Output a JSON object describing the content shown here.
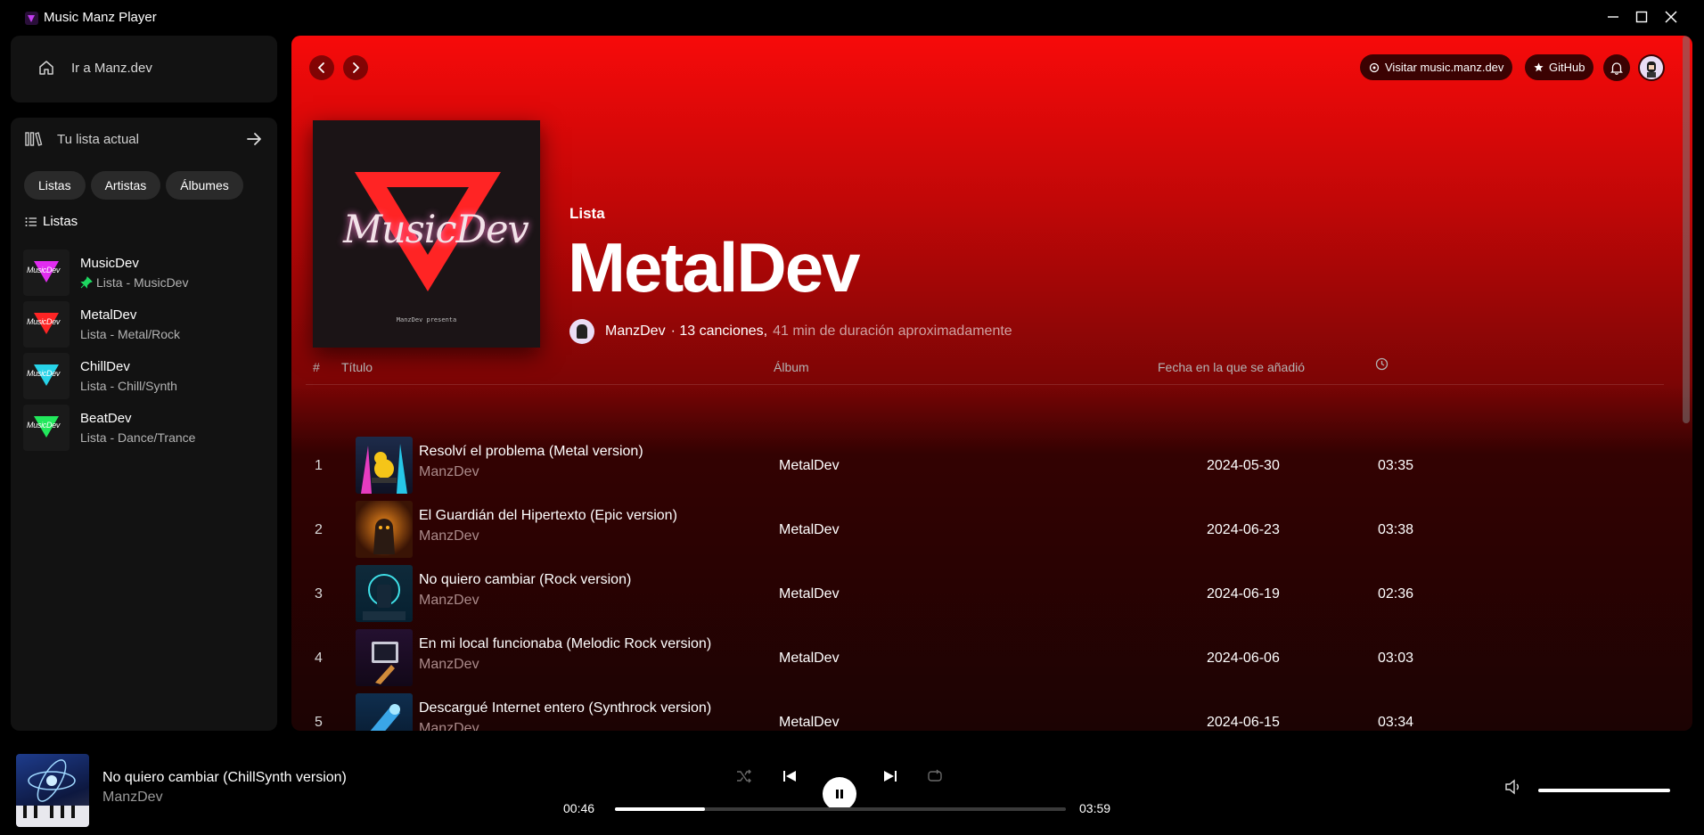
{
  "window": {
    "title": "Music Manz Player"
  },
  "home": {
    "label": "Ir a Manz.dev"
  },
  "library": {
    "header": "Tu lista actual",
    "chips": [
      "Listas",
      "Artistas",
      "Álbumes"
    ],
    "section_label": "Listas",
    "playlists": [
      {
        "name": "MusicDev",
        "subtitle": "Lista - MusicDev",
        "color": "#e22cf0",
        "pinned": true
      },
      {
        "name": "MetalDev",
        "subtitle": "Lista - Metal/Rock",
        "color": "#ff2424",
        "pinned": false
      },
      {
        "name": "ChillDev",
        "subtitle": "Lista - Chill/Synth",
        "color": "#27d3e8",
        "pinned": false
      },
      {
        "name": "BeatDev",
        "subtitle": "Lista - Dance/Trance",
        "color": "#22e85c",
        "pinned": false
      }
    ]
  },
  "topbar": {
    "visit_label": "Visitar music.manz.dev",
    "github_label": "GitHub"
  },
  "playlist_header": {
    "kind": "Lista",
    "title": "MetalDev",
    "cover_text": "MusicDev",
    "cover_credit": "ManzDev presenta",
    "owner": "ManzDev",
    "song_count": "· 13 canciones,",
    "duration": "41 min de duración aproximadamente"
  },
  "table": {
    "headers": {
      "num": "#",
      "title": "Título",
      "album": "Álbum",
      "date": "Fecha en la que se añadió"
    },
    "rows": [
      {
        "num": "1",
        "title": "Resolví el problema (Metal version)",
        "artist": "ManzDev",
        "album": "MetalDev",
        "date": "2024-05-30",
        "duration": "03:35"
      },
      {
        "num": "2",
        "title": "El Guardián del Hipertexto (Epic version)",
        "artist": "ManzDev",
        "album": "MetalDev",
        "date": "2024-06-23",
        "duration": "03:38"
      },
      {
        "num": "3",
        "title": "No quiero cambiar (Rock version)",
        "artist": "ManzDev",
        "album": "MetalDev",
        "date": "2024-06-19",
        "duration": "02:36"
      },
      {
        "num": "4",
        "title": "En mi local funcionaba (Melodic Rock version)",
        "artist": "ManzDev",
        "album": "MetalDev",
        "date": "2024-06-06",
        "duration": "03:03"
      },
      {
        "num": "5",
        "title": "Descargué Internet entero (Synthrock version)",
        "artist": "ManzDev",
        "album": "MetalDev",
        "date": "2024-06-15",
        "duration": "03:34"
      }
    ]
  },
  "player": {
    "title": "No quiero cambiar (ChillSynth version)",
    "artist": "ManzDev",
    "current_time": "00:46",
    "total_time": "03:59",
    "progress_fraction": 0.2,
    "volume_fraction": 1.0,
    "state": "playing"
  },
  "colors": {
    "accent": "#f70a0a",
    "panel": "#121212",
    "pinned": "#1ed760"
  }
}
